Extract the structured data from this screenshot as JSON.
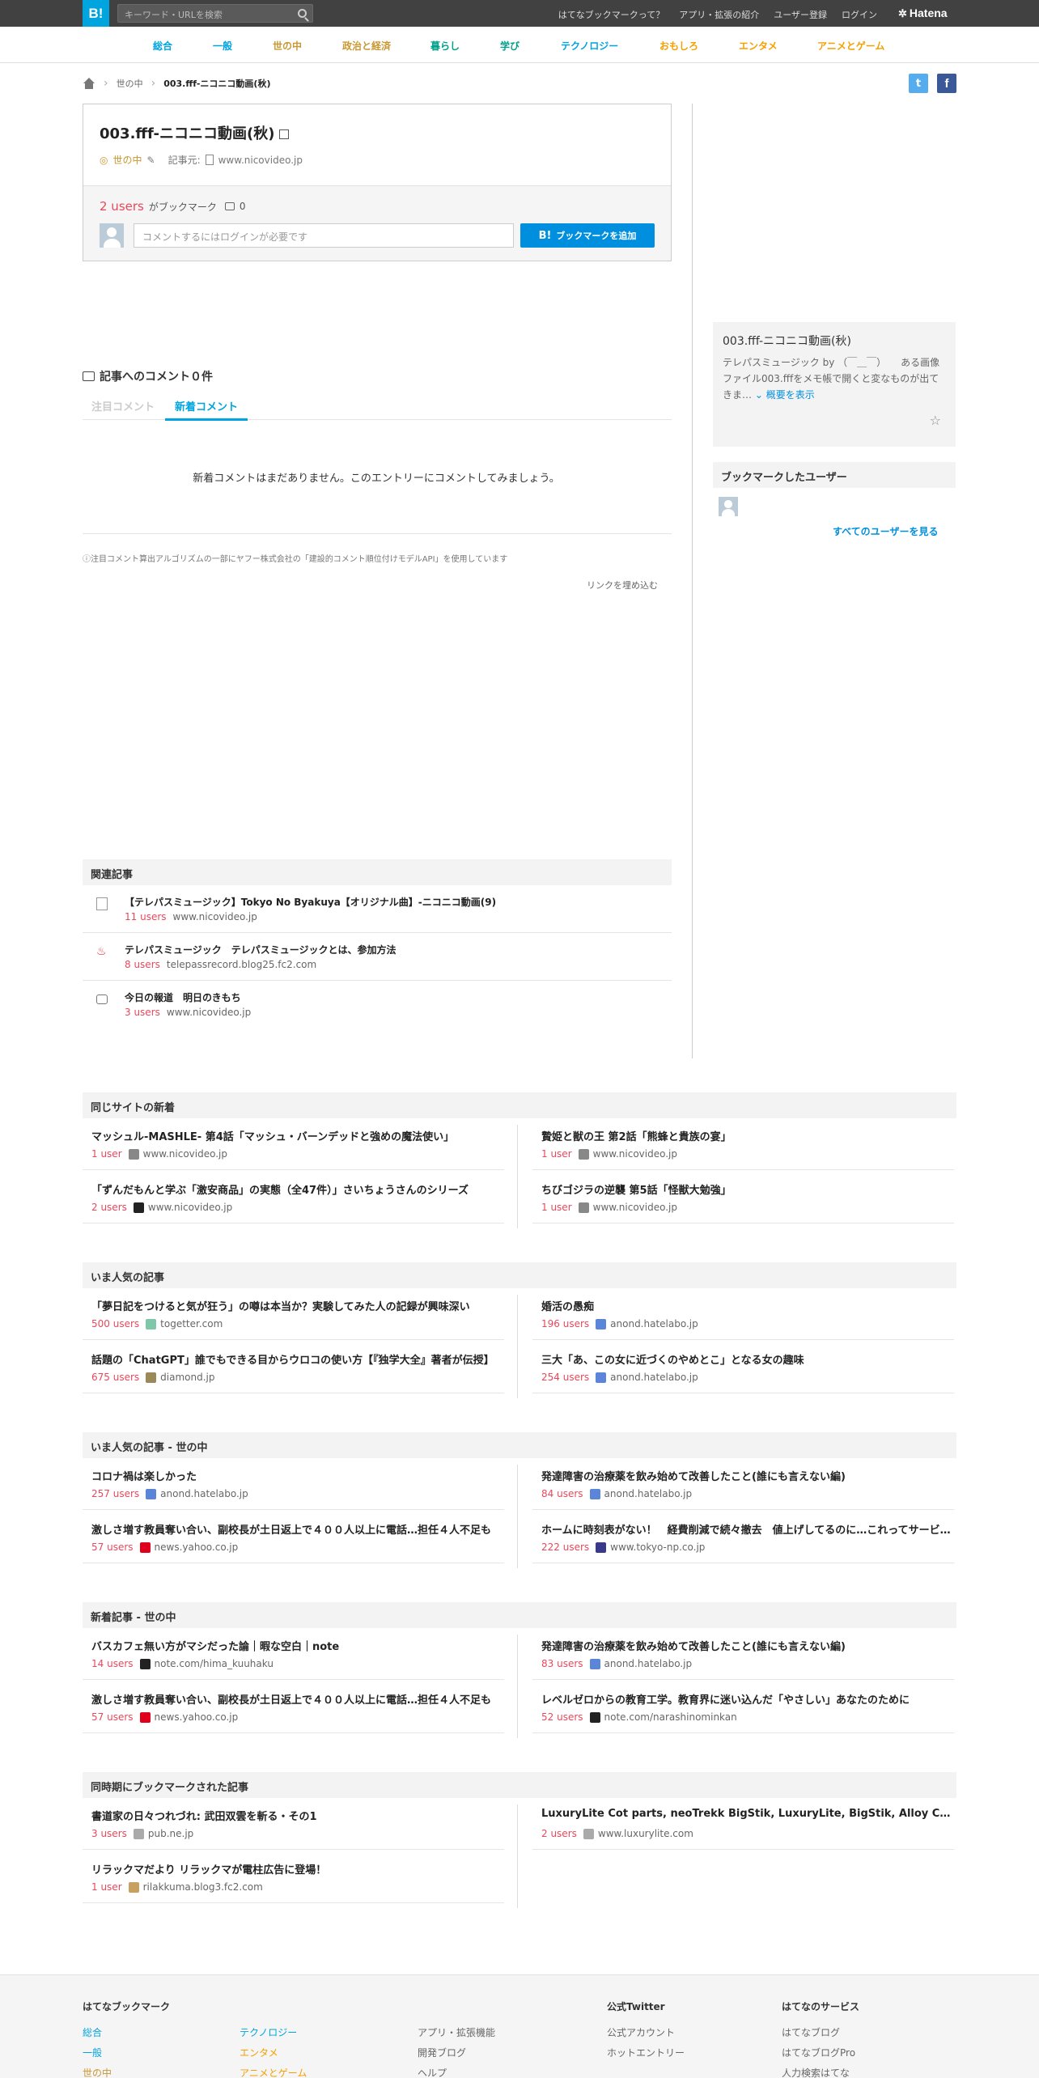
{
  "header": {
    "logo": "B!",
    "search_placeholder": "キーワード・URLを検索",
    "links": [
      "はてなブックマークって？",
      "アプリ・拡張の紹介",
      "ユーザー登録",
      "ログイン"
    ],
    "brand": "Hatena"
  },
  "categories": [
    {
      "label": "総合",
      "color": "#00a4de"
    },
    {
      "label": "一般",
      "color": "#00a4de"
    },
    {
      "label": "世の中",
      "color": "#c99833"
    },
    {
      "label": "政治と経済",
      "color": "#c99833"
    },
    {
      "label": "暮らし",
      "color": "#01a08c"
    },
    {
      "label": "学び",
      "color": "#01a08c"
    },
    {
      "label": "テクノロジー",
      "color": "#00a4de"
    },
    {
      "label": "おもしろ",
      "color": "#f5a000"
    },
    {
      "label": "エンタメ",
      "color": "#f5a000"
    },
    {
      "label": "アニメとゲーム",
      "color": "#f5a000"
    }
  ],
  "breadcrumb": {
    "category": "世の中",
    "current": "003.fff-ニコニコ動画(秋)"
  },
  "entry": {
    "title": "003.fff-ニコニコ動画(秋)",
    "category": "世の中",
    "source_label": "記事元:",
    "source_domain": "www.nicovideo.jp",
    "users_count": "2 users",
    "users_suffix": "がブックマーク",
    "comment_count": "0",
    "comment_placeholder": "コメントするにはログインが必要です",
    "bookmark_button": "ブックマークを追加",
    "bookmark_logo": "B!"
  },
  "comments": {
    "heading": "記事へのコメント０件",
    "tab_featured": "注目コメント",
    "tab_new": "新着コメント",
    "empty": "新着コメントはまだありません。このエントリーにコメントしてみましょう。",
    "note": "ⓘ注目コメント算出アルゴリズムの一部にヤフー株式会社の「建設的コメント順位付けモデルAPI」を使用しています",
    "embed": "リンクを埋め込む"
  },
  "sidebar": {
    "title": "003.fff-ニコニコ動画(秋)",
    "desc": "テレパスミュージック by （￣＿￣）　　ある画像ファイル003.fffをメモ帳で開くと変なものが出てきま…",
    "more": "概要を表示",
    "bookmarked_users_heading": "ブックマークしたユーザー",
    "see_all": "すべてのユーザーを見る"
  },
  "related": {
    "heading": "関連記事",
    "items": [
      {
        "title": "【テレパスミュージック】Tokyo No Byakuya【オリジナル曲】-ニコニコ動画(9)",
        "users": "11 users",
        "domain": "www.nicovideo.jp"
      },
      {
        "title": "テレパスミュージック　テレパスミュージックとは、参加方法",
        "users": "8 users",
        "domain": "telepassrecord.blog25.fc2.com"
      },
      {
        "title": "今日の報道　明日のきもち",
        "users": "3 users",
        "domain": "www.nicovideo.jp"
      }
    ]
  },
  "sections": [
    {
      "heading": "同じサイトの新着",
      "items": [
        {
          "title": "マッシュル-MASHLE- 第4話「マッシュ・バーンデッドと強めの魔法使い」",
          "users": "1 user",
          "domain": "www.nicovideo.jp",
          "icon_color": "#888"
        },
        {
          "title": "贄姫と獣の王 第2話「熊蜂と貴族の宴」",
          "users": "1 user",
          "domain": "www.nicovideo.jp",
          "icon_color": "#888"
        },
        {
          "title": "「ずんだもんと学ぶ「激安商品」の実態（全47件）」さいちょうさんのシリーズ",
          "users": "2 users",
          "domain": "www.nicovideo.jp",
          "icon_color": "#222"
        },
        {
          "title": "ちびゴジラの逆襲 第5話「怪獣大勉強」",
          "users": "1 user",
          "domain": "www.nicovideo.jp",
          "icon_color": "#888"
        }
      ]
    },
    {
      "heading": "いま人気の記事",
      "items": [
        {
          "title": "「夢日記をつけると気が狂う」の噂は本当か？実験してみた人の記録が興味深い",
          "users": "500 users",
          "domain": "togetter.com",
          "icon_color": "#7ec8a9"
        },
        {
          "title": "婚活の愚痴",
          "users": "196 users",
          "domain": "anond.hatelabo.jp",
          "icon_color": "#5b85d8"
        },
        {
          "title": "話題の「ChatGPT」誰でもできる目からウロコの使い方【『独学大全』著者が伝授】",
          "users": "675 users",
          "domain": "diamond.jp",
          "icon_color": "#9a8a5a"
        },
        {
          "title": "三大「あ、この女に近づくのやめとこ」となる女の趣味",
          "users": "254 users",
          "domain": "anond.hatelabo.jp",
          "icon_color": "#5b85d8"
        }
      ]
    },
    {
      "heading": "いま人気の記事 - 世の中",
      "items": [
        {
          "title": "コロナ禍は楽しかった",
          "users": "257 users",
          "domain": "anond.hatelabo.jp",
          "icon_color": "#5b85d8"
        },
        {
          "title": "発達障害の治療薬を飲み始めて改善したこと(誰にも言えない編)",
          "users": "84 users",
          "domain": "anond.hatelabo.jp",
          "icon_color": "#5b85d8"
        },
        {
          "title": "激しさ増す教員奪い合い、副校長が土日返上で４００人以上に電話…担任４人不足も",
          "users": "57 users",
          "domain": "news.yahoo.co.jp",
          "icon_color": "#e1001b"
        },
        {
          "title": "ホームに時刻表がない！　経費削減で続々撤去　値上げしてるのに…これってサービス低下",
          "users": "222 users",
          "domain": "www.tokyo-np.co.jp",
          "icon_color": "#3a3a8a"
        }
      ]
    },
    {
      "heading": "新着記事 - 世の中",
      "items": [
        {
          "title": "バスカフェ無い方がマシだった論｜暇な空白｜note",
          "users": "14 users",
          "domain": "note.com/hima_kuuhaku",
          "icon_color": "#222"
        },
        {
          "title": "発達障害の治療薬を飲み始めて改善したこと(誰にも言えない編)",
          "users": "83 users",
          "domain": "anond.hatelabo.jp",
          "icon_color": "#5b85d8"
        },
        {
          "title": "激しさ増す教員奪い合い、副校長が土日返上で４００人以上に電話…担任４人不足も",
          "users": "57 users",
          "domain": "news.yahoo.co.jp",
          "icon_color": "#e1001b"
        },
        {
          "title": "レベルゼロからの教育工学。教育界に迷い込んだ「やさしい」あなたのために",
          "users": "52 users",
          "domain": "note.com/narashinominkan",
          "icon_color": "#222"
        }
      ]
    },
    {
      "heading": "同時期にブックマークされた記事",
      "items": [
        {
          "title": "書道家の日々つれづれ: 武田双雲を斬る・その1",
          "users": "3 users",
          "domain": "pub.ne.jp",
          "icon_color": "#aaa"
        },
        {
          "title": "LuxuryLite Cot parts, neoTrekk BigStik, LuxuryLite, BigStik, Alloy Cot Parts",
          "users": "2 users",
          "domain": "www.luxurylite.com",
          "icon_color": "#aaa"
        },
        {
          "title": "リラックマだより リラックマが電柱広告に登場！",
          "users": "1 user",
          "domain": "rilakkuma.blog3.fc2.com",
          "icon_color": "#c8a060"
        }
      ]
    }
  ],
  "footer": {
    "col1_heading": "はてなブックマーク",
    "col1_a": [
      "総合",
      "一般",
      "世の中"
    ],
    "col1_b": [
      "テクノロジー",
      "エンタメ",
      "アニメとゲーム"
    ],
    "col2": [
      "アプリ・拡張機能",
      "開発ブログ",
      "ヘルプ"
    ],
    "col3_heading": "公式Twitter",
    "col3": [
      "公式アカウント",
      "ホットエントリー"
    ],
    "col4_heading": "はてなのサービス",
    "col4": [
      "はてなブログ",
      "はてなブログPro",
      "人力検索はてな"
    ]
  }
}
